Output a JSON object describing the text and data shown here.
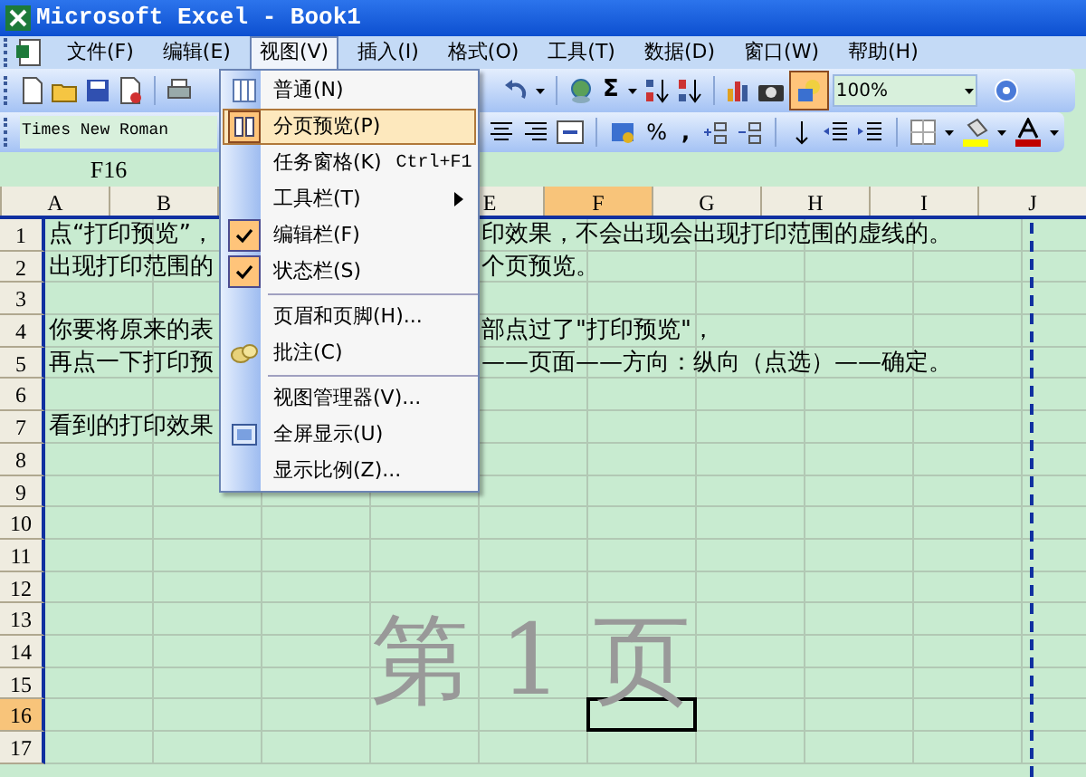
{
  "window": {
    "title": "Microsoft Excel - Book1"
  },
  "menubar": [
    {
      "label": "文件(F)",
      "selected": false
    },
    {
      "label": "编辑(E)",
      "selected": false
    },
    {
      "label": "视图(V)",
      "selected": true
    },
    {
      "label": "插入(I)",
      "selected": false
    },
    {
      "label": "格式(O)",
      "selected": false
    },
    {
      "label": "工具(T)",
      "selected": false
    },
    {
      "label": "数据(D)",
      "selected": false
    },
    {
      "label": "窗口(W)",
      "selected": false
    },
    {
      "label": "帮助(H)",
      "selected": false
    }
  ],
  "toolbar_standard": {
    "autosum_label": "Σ",
    "drawing_on": true,
    "zoom": "100%"
  },
  "toolbar_formatting": {
    "font": "Times New Roman",
    "percent_label": "%",
    "comma_label": ","
  },
  "name_box": "F16",
  "columns": [
    {
      "label": "A",
      "selected": false
    },
    {
      "label": "B",
      "selected": false
    },
    {
      "label": "E",
      "selected": false
    },
    {
      "label": "F",
      "selected": true
    },
    {
      "label": "G",
      "selected": false
    },
    {
      "label": "H",
      "selected": false
    },
    {
      "label": "I",
      "selected": false
    },
    {
      "label": "J",
      "selected": false
    }
  ],
  "rows": [
    {
      "label": "1",
      "selected": false,
      "left_text": "点“打印预览”，",
      "right_text": "印效果，不会出现会出现打印范围的虚线的。"
    },
    {
      "label": "2",
      "selected": false,
      "left_text": "出现打印范围的",
      "right_text": "个页预览。"
    },
    {
      "label": "3",
      "selected": false
    },
    {
      "label": "4",
      "selected": false,
      "left_text": "你要将原来的表",
      "right_text": "部点过了\"打印预览\"，"
    },
    {
      "label": "5",
      "selected": false,
      "left_text": "再点一下打印预",
      "right_text": "——页面——方向：纵向（点选）——确定。"
    },
    {
      "label": "6",
      "selected": false
    },
    {
      "label": "7",
      "selected": false,
      "left_text": "看到的打印效果"
    },
    {
      "label": "8",
      "selected": false
    },
    {
      "label": "9",
      "selected": false
    },
    {
      "label": "10",
      "selected": false
    },
    {
      "label": "11",
      "selected": false
    },
    {
      "label": "12",
      "selected": false
    },
    {
      "label": "13",
      "selected": false
    },
    {
      "label": "14",
      "selected": false
    },
    {
      "label": "15",
      "selected": false
    },
    {
      "label": "16",
      "selected": true
    },
    {
      "label": "17",
      "selected": false
    }
  ],
  "page_label": "第 1 页",
  "view_menu": [
    {
      "kind": "item",
      "label": "普通(N)",
      "selected": false
    },
    {
      "kind": "item",
      "label": "分页预览(P)",
      "selected": true
    },
    {
      "kind": "item",
      "label": "任务窗格(K)",
      "shortcut": "Ctrl+F1",
      "selected": false
    },
    {
      "kind": "submenu",
      "label": "工具栏(T)",
      "selected": false
    },
    {
      "kind": "check",
      "label": "编辑栏(F)",
      "checked": true,
      "selected": false
    },
    {
      "kind": "check",
      "label": "状态栏(S)",
      "checked": true,
      "selected": false
    },
    {
      "kind": "separator"
    },
    {
      "kind": "item",
      "label": "页眉和页脚(H)...",
      "selected": false
    },
    {
      "kind": "item",
      "label": "批注(C)",
      "selected": false
    },
    {
      "kind": "separator"
    },
    {
      "kind": "item",
      "label": "视图管理器(V)...",
      "selected": false
    },
    {
      "kind": "item",
      "label": "全屏显示(U)",
      "selected": false
    },
    {
      "kind": "item",
      "label": "显示比例(Z)...",
      "selected": false
    }
  ]
}
